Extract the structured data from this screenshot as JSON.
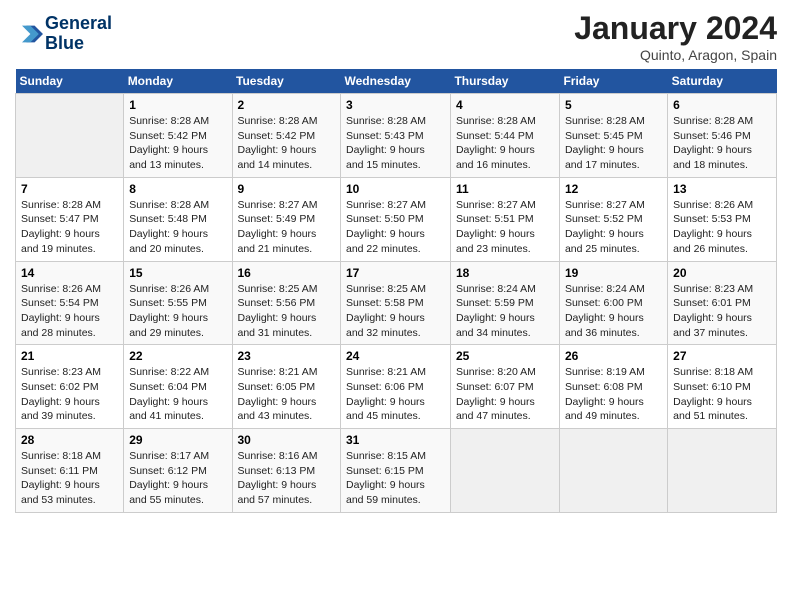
{
  "logo": {
    "line1": "General",
    "line2": "Blue"
  },
  "title": "January 2024",
  "subtitle": "Quinto, Aragon, Spain",
  "days_header": [
    "Sunday",
    "Monday",
    "Tuesday",
    "Wednesday",
    "Thursday",
    "Friday",
    "Saturday"
  ],
  "weeks": [
    [
      {
        "day": "",
        "info": ""
      },
      {
        "day": "1",
        "info": "Sunrise: 8:28 AM\nSunset: 5:42 PM\nDaylight: 9 hours\nand 13 minutes."
      },
      {
        "day": "2",
        "info": "Sunrise: 8:28 AM\nSunset: 5:42 PM\nDaylight: 9 hours\nand 14 minutes."
      },
      {
        "day": "3",
        "info": "Sunrise: 8:28 AM\nSunset: 5:43 PM\nDaylight: 9 hours\nand 15 minutes."
      },
      {
        "day": "4",
        "info": "Sunrise: 8:28 AM\nSunset: 5:44 PM\nDaylight: 9 hours\nand 16 minutes."
      },
      {
        "day": "5",
        "info": "Sunrise: 8:28 AM\nSunset: 5:45 PM\nDaylight: 9 hours\nand 17 minutes."
      },
      {
        "day": "6",
        "info": "Sunrise: 8:28 AM\nSunset: 5:46 PM\nDaylight: 9 hours\nand 18 minutes."
      }
    ],
    [
      {
        "day": "7",
        "info": "Sunrise: 8:28 AM\nSunset: 5:47 PM\nDaylight: 9 hours\nand 19 minutes."
      },
      {
        "day": "8",
        "info": "Sunrise: 8:28 AM\nSunset: 5:48 PM\nDaylight: 9 hours\nand 20 minutes."
      },
      {
        "day": "9",
        "info": "Sunrise: 8:27 AM\nSunset: 5:49 PM\nDaylight: 9 hours\nand 21 minutes."
      },
      {
        "day": "10",
        "info": "Sunrise: 8:27 AM\nSunset: 5:50 PM\nDaylight: 9 hours\nand 22 minutes."
      },
      {
        "day": "11",
        "info": "Sunrise: 8:27 AM\nSunset: 5:51 PM\nDaylight: 9 hours\nand 23 minutes."
      },
      {
        "day": "12",
        "info": "Sunrise: 8:27 AM\nSunset: 5:52 PM\nDaylight: 9 hours\nand 25 minutes."
      },
      {
        "day": "13",
        "info": "Sunrise: 8:26 AM\nSunset: 5:53 PM\nDaylight: 9 hours\nand 26 minutes."
      }
    ],
    [
      {
        "day": "14",
        "info": "Sunrise: 8:26 AM\nSunset: 5:54 PM\nDaylight: 9 hours\nand 28 minutes."
      },
      {
        "day": "15",
        "info": "Sunrise: 8:26 AM\nSunset: 5:55 PM\nDaylight: 9 hours\nand 29 minutes."
      },
      {
        "day": "16",
        "info": "Sunrise: 8:25 AM\nSunset: 5:56 PM\nDaylight: 9 hours\nand 31 minutes."
      },
      {
        "day": "17",
        "info": "Sunrise: 8:25 AM\nSunset: 5:58 PM\nDaylight: 9 hours\nand 32 minutes."
      },
      {
        "day": "18",
        "info": "Sunrise: 8:24 AM\nSunset: 5:59 PM\nDaylight: 9 hours\nand 34 minutes."
      },
      {
        "day": "19",
        "info": "Sunrise: 8:24 AM\nSunset: 6:00 PM\nDaylight: 9 hours\nand 36 minutes."
      },
      {
        "day": "20",
        "info": "Sunrise: 8:23 AM\nSunset: 6:01 PM\nDaylight: 9 hours\nand 37 minutes."
      }
    ],
    [
      {
        "day": "21",
        "info": "Sunrise: 8:23 AM\nSunset: 6:02 PM\nDaylight: 9 hours\nand 39 minutes."
      },
      {
        "day": "22",
        "info": "Sunrise: 8:22 AM\nSunset: 6:04 PM\nDaylight: 9 hours\nand 41 minutes."
      },
      {
        "day": "23",
        "info": "Sunrise: 8:21 AM\nSunset: 6:05 PM\nDaylight: 9 hours\nand 43 minutes."
      },
      {
        "day": "24",
        "info": "Sunrise: 8:21 AM\nSunset: 6:06 PM\nDaylight: 9 hours\nand 45 minutes."
      },
      {
        "day": "25",
        "info": "Sunrise: 8:20 AM\nSunset: 6:07 PM\nDaylight: 9 hours\nand 47 minutes."
      },
      {
        "day": "26",
        "info": "Sunrise: 8:19 AM\nSunset: 6:08 PM\nDaylight: 9 hours\nand 49 minutes."
      },
      {
        "day": "27",
        "info": "Sunrise: 8:18 AM\nSunset: 6:10 PM\nDaylight: 9 hours\nand 51 minutes."
      }
    ],
    [
      {
        "day": "28",
        "info": "Sunrise: 8:18 AM\nSunset: 6:11 PM\nDaylight: 9 hours\nand 53 minutes."
      },
      {
        "day": "29",
        "info": "Sunrise: 8:17 AM\nSunset: 6:12 PM\nDaylight: 9 hours\nand 55 minutes."
      },
      {
        "day": "30",
        "info": "Sunrise: 8:16 AM\nSunset: 6:13 PM\nDaylight: 9 hours\nand 57 minutes."
      },
      {
        "day": "31",
        "info": "Sunrise: 8:15 AM\nSunset: 6:15 PM\nDaylight: 9 hours\nand 59 minutes."
      },
      {
        "day": "",
        "info": ""
      },
      {
        "day": "",
        "info": ""
      },
      {
        "day": "",
        "info": ""
      }
    ]
  ]
}
